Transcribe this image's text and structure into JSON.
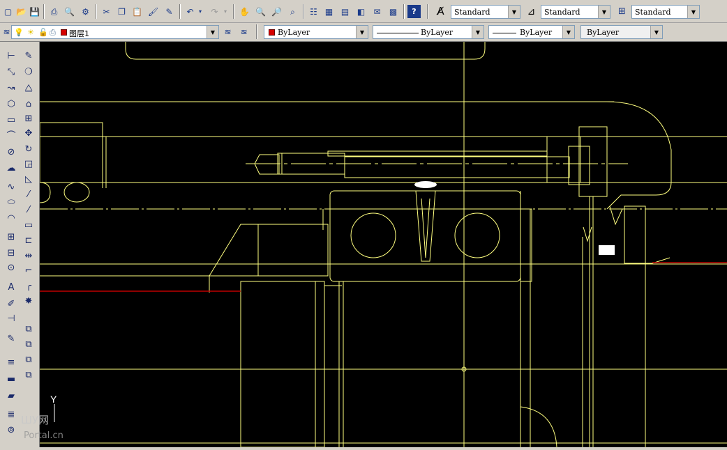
{
  "toolbar_standard": {
    "icons": [
      "new-icon",
      "open-icon",
      "save-icon",
      "print-icon",
      "plot-preview-icon",
      "publish-icon",
      "cut-icon",
      "copy-icon",
      "paste-icon",
      "match-properties-icon",
      "block-editor-icon",
      "undo-icon",
      "undo-dropdown-icon",
      "redo-icon",
      "redo-dropdown-icon",
      "pan-icon",
      "zoom-realtime-icon",
      "zoom-window-icon",
      "zoom-previous-icon",
      "properties-icon",
      "design-center-icon",
      "tool-palettes-icon",
      "sheet-set-icon",
      "markup-icon",
      "calculator-icon",
      "help-icon"
    ]
  },
  "styles_toolbar": {
    "text_style": "Standard",
    "dim_style": "Standard",
    "table_style": "Standard"
  },
  "layers_toolbar": {
    "layer_name": "图层1"
  },
  "properties_toolbar": {
    "color": "ByLayer",
    "linetype": "ByLayer",
    "lineweight": "ByLayer",
    "plot_style": "ByLayer"
  },
  "draw_toolbar": {
    "icons": [
      "line-icon",
      "construction-line-icon",
      "polyline-icon",
      "polygon-icon",
      "rectangle-icon",
      "arc-icon",
      "circle-icon",
      "revision-cloud-icon",
      "spline-icon",
      "ellipse-icon",
      "ellipse-arc-icon",
      "insert-block-icon",
      "make-block-icon",
      "point-icon",
      "hatch-icon",
      "gradient-icon",
      "region-icon",
      "table-icon",
      "multiline-text-icon"
    ]
  },
  "modify_toolbar": {
    "icons": [
      "erase-icon",
      "copy-object-icon",
      "mirror-icon",
      "offset-icon",
      "array-icon",
      "move-icon",
      "rotate-icon",
      "scale-icon",
      "stretch-icon",
      "trim-icon",
      "extend-icon",
      "break-at-point-icon",
      "break-icon",
      "join-icon",
      "chamfer-icon",
      "fillet-icon",
      "explode-icon"
    ]
  },
  "canvas": {
    "background": "#000000",
    "line_color": "#ffff80",
    "accent_red": "#c00000",
    "ucs_label": "Y"
  },
  "watermark": {
    "line1": "ШУ网",
    "line2": "Portal.cn"
  }
}
